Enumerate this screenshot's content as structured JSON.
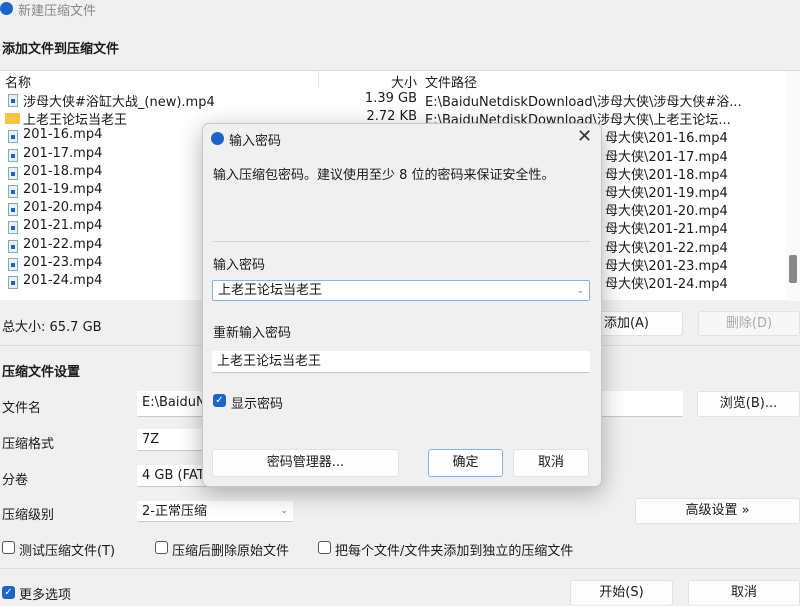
{
  "window": {
    "title": "新建压缩文件"
  },
  "add_section": {
    "heading": "添加文件到压缩文件"
  },
  "file_list": {
    "columns": [
      "名称",
      "大小",
      "文件路径"
    ],
    "rows": [
      {
        "name": "涉母大侠#浴缸大战_(new).mp4",
        "size": "1.39 GB",
        "path": "E:\\BaiduNetdiskDownload\\涉母大侠\\涉母大侠#浴...",
        "type": "file"
      },
      {
        "name": "上老王论坛当老王",
        "size": "2.72 KB",
        "path": "E:\\BaiduNetdiskDownload\\涉母大侠\\上老王论坛...",
        "type": "folder"
      },
      {
        "name": "201-16.mp4",
        "size": "",
        "path": "母大侠\\201-16.mp4",
        "type": "file"
      },
      {
        "name": "201-17.mp4",
        "size": "",
        "path": "母大侠\\201-17.mp4",
        "type": "file"
      },
      {
        "name": "201-18.mp4",
        "size": "",
        "path": "母大侠\\201-18.mp4",
        "type": "file"
      },
      {
        "name": "201-19.mp4",
        "size": "",
        "path": "母大侠\\201-19.mp4",
        "type": "file"
      },
      {
        "name": "201-20.mp4",
        "size": "",
        "path": "母大侠\\201-20.mp4",
        "type": "file"
      },
      {
        "name": "201-21.mp4",
        "size": "",
        "path": "母大侠\\201-21.mp4",
        "type": "file"
      },
      {
        "name": "201-22.mp4",
        "size": "",
        "path": "母大侠\\201-22.mp4",
        "type": "file"
      },
      {
        "name": "201-23.mp4",
        "size": "",
        "path": "母大侠\\201-23.mp4",
        "type": "file"
      },
      {
        "name": "201-24.mp4",
        "size": "",
        "path": "母大侠\\201-24.mp4",
        "type": "file"
      }
    ]
  },
  "total_size": "总大小: 65.7 GB",
  "buttons": {
    "add": "添加(A)",
    "delete": "删除(D)",
    "browse": "浏览(B)...",
    "advanced": "高级设置 »",
    "start": "开始(S)",
    "cancel": "取消"
  },
  "settings": {
    "heading": "压缩文件设置",
    "filename_label": "文件名",
    "filename_value": "E:\\BaiduN",
    "format_label": "压缩格式",
    "format_value": "7Z",
    "split_label": "分卷",
    "split_value": "4 GB (FAT",
    "level_label": "压缩级别",
    "level_value": "2-正常压缩",
    "test_label": "测试压缩文件(T)",
    "test_checked": false,
    "delete_label": "压缩后删除原始文件",
    "delete_checked": false,
    "separate_label": "把每个文件/文件夹添加到独立的压缩文件",
    "separate_checked": false,
    "more_label": "更多选项",
    "more_checked": true
  },
  "dialog": {
    "title": "输入密码",
    "description": "输入压缩包密码。建议使用至少 8 位的密码来保证安全性。",
    "password_label": "输入密码",
    "password_value": "上老王论坛当老王",
    "confirm_label": "重新输入密码",
    "confirm_value": "上老王论坛当老王",
    "show_password": "显示密码",
    "show_checked": true,
    "manager": "密码管理器...",
    "ok": "确定",
    "cancel": "取消"
  },
  "colors": {
    "accent": "#1e64c8"
  }
}
